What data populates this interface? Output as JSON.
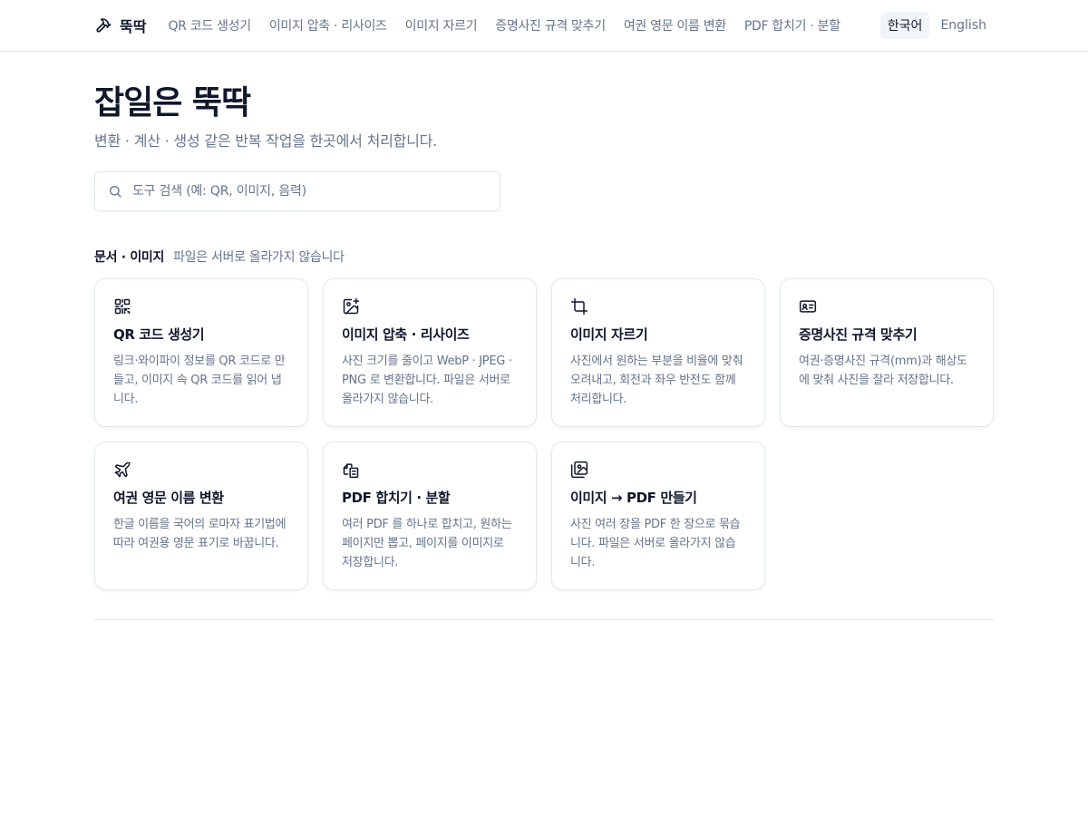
{
  "header": {
    "brand": "뚝딱",
    "nav": [
      {
        "label": "QR 코드 생성기"
      },
      {
        "label": "이미지 압축 · 리사이즈"
      },
      {
        "label": "이미지 자르기"
      },
      {
        "label": "증명사진 규격 맞추기"
      },
      {
        "label": "여권 영문 이름 변환"
      },
      {
        "label": "PDF 합치기 · 분할"
      }
    ],
    "lang": {
      "ko": "한국어",
      "en": "English",
      "selected": "한국어"
    }
  },
  "hero": {
    "title": "잡일은 뚝딱",
    "subtitle": "변환 · 계산 · 생성 같은 반복 작업을 한곳에서 처리합니다."
  },
  "search": {
    "placeholder": "도구 검색 (예: QR, 이미지, 음력)",
    "value": ""
  },
  "section": {
    "title": "문서 · 이미지",
    "note": "파일은 서버로 올라가지 않습니다",
    "cards": [
      {
        "icon": "qr-code-icon",
        "title": "QR 코드 생성기",
        "desc": "링크·와이파이 정보를 QR 코드로 만들고, 이미지 속 QR 코드를 읽어 냅니다."
      },
      {
        "icon": "image-resize-icon",
        "title": "이미지 압축 · 리사이즈",
        "desc": "사진 크기를 줄이고 WebP · JPEG · PNG 로 변환합니다. 파일은 서버로 올라가지 않습니다."
      },
      {
        "icon": "crop-icon",
        "title": "이미지 자르기",
        "desc": "사진에서 원하는 부분을 비율에 맞춰 오려내고, 회전과 좌우 반전도 함께 처리합니다."
      },
      {
        "icon": "id-card-icon",
        "title": "증명사진 규격 맞추기",
        "desc": "여권·증명사진 규격(mm)과 해상도에 맞춰 사진을 잘라 저장합니다."
      },
      {
        "icon": "plane-icon",
        "title": "여권 영문 이름 변환",
        "desc": "한글 이름을 국어의 로마자 표기법에 따라 여권용 영문 표기로 바꿉니다."
      },
      {
        "icon": "copy-files-icon",
        "title": "PDF 합치기 · 분할",
        "desc": "여러 PDF 를 하나로 합치고, 원하는 페이지만 뽑고, 페이지를 이미지로 저장합니다."
      },
      {
        "icon": "images-icon",
        "title": "이미지 → PDF 만들기",
        "desc": "사진 여러 장을 PDF 한 장으로 묶습니다. 파일은 서버로 올라가지 않습니다."
      }
    ]
  },
  "colors": {
    "text": "#0f172a",
    "muted": "#64748b",
    "border": "#e2e8f0",
    "active_bg": "#f1f5f9"
  }
}
